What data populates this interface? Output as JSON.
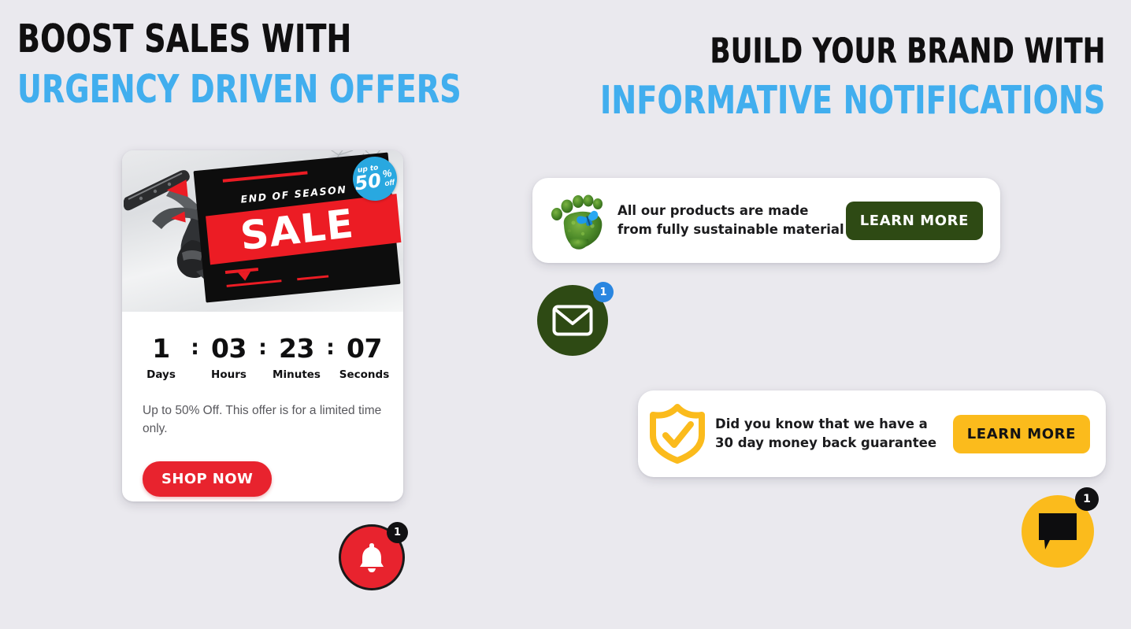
{
  "colors": {
    "background": "#eae9ee",
    "accent_blue": "#41aeee",
    "heading_black": "#100f10",
    "red": "#e8232e",
    "dark_green": "#2e4a14",
    "yellow": "#fbbb1c",
    "badge_blue": "#2a86e0",
    "body_gray": "#58585d"
  },
  "headings": {
    "left": {
      "line1": "BOOST SALES WITH",
      "line2": "URGENCY DRIVEN OFFERS"
    },
    "right": {
      "line1": "BUILD YOUR BRAND WITH",
      "line2": "INFORMATIVE NOTIFICATIONS"
    }
  },
  "promo_card": {
    "image": {
      "eyebrow": "END OF SEASON",
      "headline": "SALE",
      "badge": {
        "upto": "up to",
        "number": "50",
        "percent": "%",
        "off": "off"
      },
      "alt": "snowboarder-on-snow"
    },
    "countdown": {
      "separator": ":",
      "units": [
        {
          "value": "1",
          "label": "Days"
        },
        {
          "value": "03",
          "label": "Hours"
        },
        {
          "value": "23",
          "label": "Minutes"
        },
        {
          "value": "07",
          "label": "Seconds"
        }
      ]
    },
    "description": "Up to 50% Off. This offer is for a limited time only.",
    "cta_label": "SHOP NOW"
  },
  "notifications": [
    {
      "id": "sustainable",
      "icon": "green-footprint-icon",
      "line1": "All our products are made",
      "line2": "from fully sustainable material",
      "button_label": "LEARN MORE"
    },
    {
      "id": "guarantee",
      "icon": "shield-check-icon",
      "line1": "Did you know that we have a",
      "line2": "30 day money back guarantee",
      "button_label": "LEARN MORE"
    }
  ],
  "floating_buttons": [
    {
      "id": "bell",
      "icon": "bell-icon",
      "badge_count": "1"
    },
    {
      "id": "mail",
      "icon": "envelope-icon",
      "badge_count": "1"
    },
    {
      "id": "chat",
      "icon": "chat-bubble-icon",
      "badge_count": "1"
    }
  ]
}
